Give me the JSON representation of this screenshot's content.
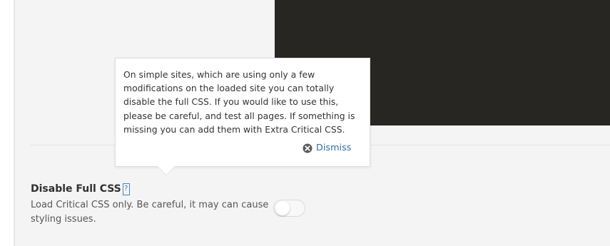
{
  "colors": {
    "panel_background": "#f4f4f4",
    "preview_background": "#272622",
    "tooltip_background": "#ffffff",
    "link_blue": "#2f6fa9",
    "help_icon_blue": "#3f77b8"
  },
  "setting": {
    "title": "Disable Full CSS",
    "help_icon_label": "?",
    "description": "Load Critical CSS only. Be careful, it may can cause styling issues.",
    "toggle_state": "off"
  },
  "tooltip": {
    "text": "On simple sites, which are using only a few modifications on the loaded site you can totally disable the full CSS. If you would like to use this, please be careful, and test all pages. If something is missing you can add them with Extra Critical CSS.",
    "dismiss_label": "Dismiss",
    "dismiss_icon": "close-circle-icon"
  }
}
